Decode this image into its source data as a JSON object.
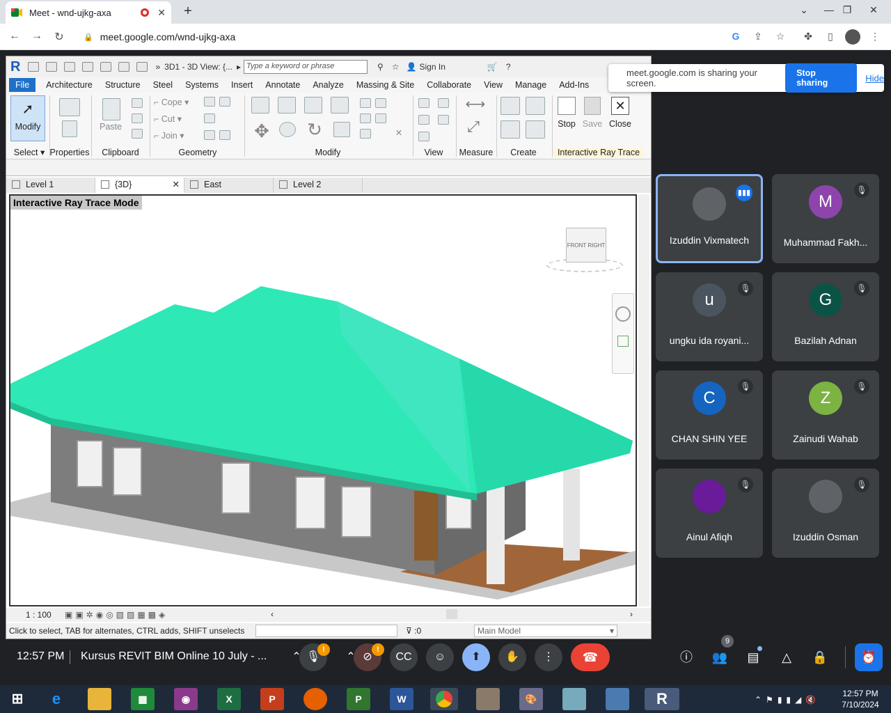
{
  "browser": {
    "tab_title": "Meet - wnd-ujkg-axa",
    "url": "meet.google.com/wnd-ujkg-axa"
  },
  "revit": {
    "view_title": "3D1 - 3D View: {...",
    "search_placeholder": "Type a keyword or phrase",
    "sign_in": "Sign In",
    "tabs": [
      "File",
      "Architecture",
      "Structure",
      "Steel",
      "Systems",
      "Insert",
      "Annotate",
      "Analyze",
      "Massing & Site",
      "Collaborate",
      "View",
      "Manage",
      "Add-Ins"
    ],
    "ribbon": {
      "modify": "Modify",
      "select": "Select",
      "properties": "Properties",
      "paste": "Paste",
      "clipboard": "Clipboard",
      "cope": "Cope",
      "cut": "Cut",
      "join": "Join",
      "geometry": "Geometry",
      "modify_group": "Modify",
      "view": "View",
      "measure": "Measure",
      "create": "Create",
      "stop": "Stop",
      "save": "Save",
      "close": "Close",
      "irt": "Interactive Ray Trace"
    },
    "view_tabs": [
      "Level 1",
      "{3D}",
      "East",
      "Level 2"
    ],
    "canvas_label": "Interactive Ray Trace Mode",
    "viewcube": {
      "front": "FRONT",
      "right": "RIGHT"
    },
    "scale": "1 : 100",
    "status": "Click to select, TAB for alternates, CTRL adds, SHIFT unselects",
    "filter_count": ":0",
    "model": "Main Model"
  },
  "share_banner": {
    "message": "meet.google.com is sharing your screen.",
    "stop": "Stop sharing",
    "hide": "Hide"
  },
  "participants": [
    {
      "name": "Izuddin Vixmatech",
      "initial": "",
      "color": "#5f6368",
      "speaking": true
    },
    {
      "name": "Muhammad Fakh...",
      "initial": "M",
      "color": "#8e44ad",
      "speaking": false
    },
    {
      "name": "ungku ida royani...",
      "initial": "u",
      "color": "#4a5560",
      "speaking": false
    },
    {
      "name": "Bazilah Adnan",
      "initial": "G",
      "color": "#0b5345",
      "speaking": false
    },
    {
      "name": "CHAN SHIN YEE",
      "initial": "C",
      "color": "#1565c0",
      "speaking": false
    },
    {
      "name": "Zainudi Wahab",
      "initial": "Z",
      "color": "#7cb342",
      "speaking": false
    },
    {
      "name": "Ainul Afiqh",
      "initial": "",
      "color": "#6a1b9a",
      "speaking": false
    },
    {
      "name": "Izuddin Osman",
      "initial": "",
      "color": "#5f6368",
      "speaking": false
    }
  ],
  "meeting": {
    "time": "12:57 PM",
    "title": "Kursus REVIT BIM Online 10 July - ...",
    "people_count": "9"
  },
  "taskbar": {
    "time": "12:57 PM",
    "date": "7/10/2024"
  },
  "colors": {
    "roof": "#2ee8b6",
    "meet_bg": "#202124",
    "accent": "#1a73e8",
    "end": "#ea4335"
  }
}
